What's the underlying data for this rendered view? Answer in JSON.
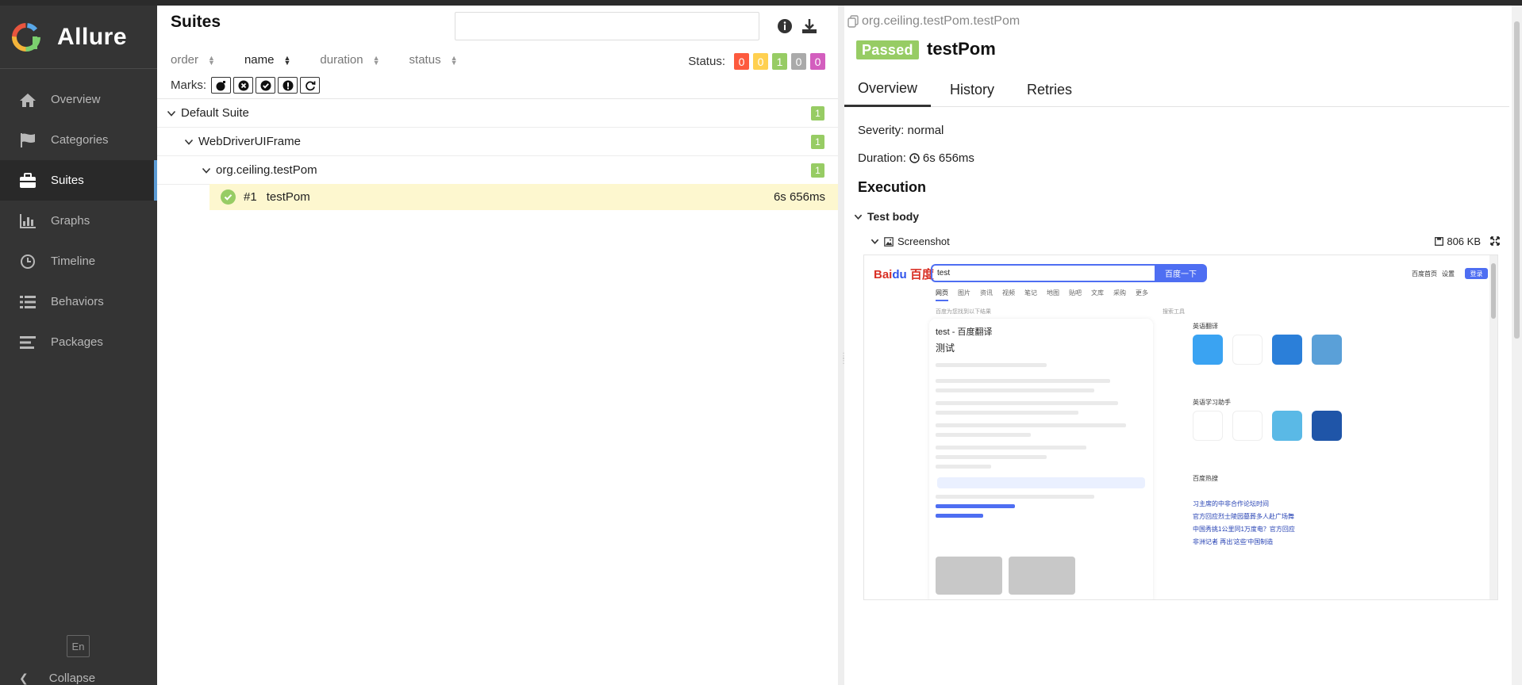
{
  "app": {
    "name": "Allure",
    "language": "En",
    "collapse_label": "Collapse"
  },
  "sidebar": {
    "items": [
      {
        "label": "Overview",
        "icon": "home-icon"
      },
      {
        "label": "Categories",
        "icon": "flag-icon"
      },
      {
        "label": "Suites",
        "icon": "briefcase-icon",
        "active": true
      },
      {
        "label": "Graphs",
        "icon": "bar-chart-icon"
      },
      {
        "label": "Timeline",
        "icon": "clock-icon"
      },
      {
        "label": "Behaviors",
        "icon": "list-icon"
      },
      {
        "label": "Packages",
        "icon": "align-left-icon"
      }
    ]
  },
  "suites": {
    "title": "Suites",
    "search_value": "",
    "sort_columns": [
      "order",
      "name",
      "duration",
      "status"
    ],
    "active_sort": "name",
    "status_label": "Status:",
    "status_counts": [
      {
        "value": "0",
        "color": "#fd5a3e"
      },
      {
        "value": "0",
        "color": "#ffd050"
      },
      {
        "value": "1",
        "color": "#97cc64"
      },
      {
        "value": "0",
        "color": "#aaaaaa"
      },
      {
        "value": "0",
        "color": "#d35ebe"
      }
    ],
    "marks_label": "Marks:",
    "tree": [
      {
        "label": "Default Suite",
        "count": "1",
        "level": 0
      },
      {
        "label": "WebDriverUIFrame",
        "count": "1",
        "level": 1
      },
      {
        "label": "org.ceiling.testPom",
        "count": "1",
        "level": 2
      }
    ],
    "leaf": {
      "number": "#1",
      "name": "testPom",
      "duration": "6s 656ms"
    }
  },
  "detail": {
    "path": "org.ceiling.testPom.testPom",
    "status": "Passed",
    "title": "testPom",
    "tabs": [
      "Overview",
      "History",
      "Retries"
    ],
    "active_tab": "Overview",
    "severity": "Severity: normal",
    "duration_label": "Duration:",
    "duration": "6s 656ms",
    "execution": "Execution",
    "test_body": "Test body",
    "attachment_name": "Screenshot",
    "attachment_size": "806 KB",
    "embedded": {
      "query": "test",
      "button": "百度一下",
      "top_links": [
        "百度首页",
        "设置"
      ],
      "login": "登录",
      "tabs": [
        "网页",
        "图片",
        "资讯",
        "视频",
        "笔记",
        "地图",
        "贴吧",
        "文库",
        "采购",
        "更多"
      ],
      "result_hint": "百度为您找到以下结果",
      "tools": "搜索工具",
      "card_title": "test - 百度翻译",
      "card_word": "测试",
      "right_sections": [
        "英语翻译",
        "英语学习助手",
        "百度热搜"
      ],
      "news": [
        "习主席的中非合作论坛时间",
        "官方回应烈士陵园墓葬多人赴广场舞",
        "中国秀挑1公里同1万度电？官方回应",
        "非洲记者 再出'这些'中国制造"
      ]
    }
  }
}
